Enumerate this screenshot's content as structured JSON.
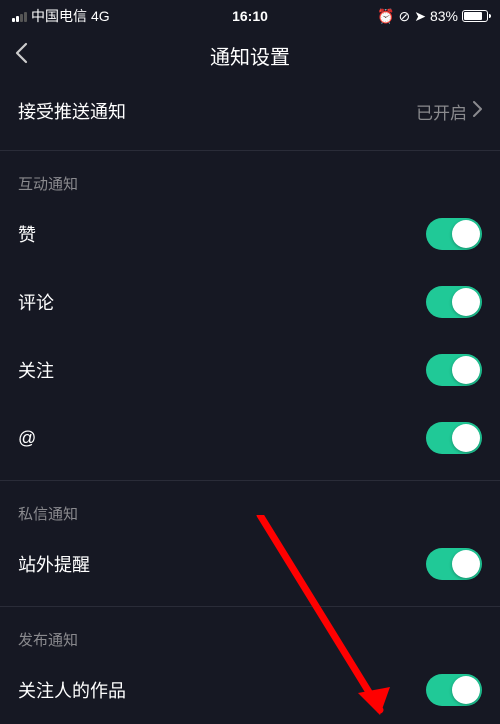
{
  "statusBar": {
    "carrier": "中国电信",
    "network": "4G",
    "time": "16:10",
    "batteryPercent": "83%",
    "icons": [
      "alarm",
      "orientation-lock",
      "location"
    ]
  },
  "nav": {
    "title": "通知设置"
  },
  "pushRow": {
    "label": "接受推送通知",
    "value": "已开启"
  },
  "sections": [
    {
      "header": "互动通知",
      "items": [
        {
          "label": "赞",
          "on": true
        },
        {
          "label": "评论",
          "on": true
        },
        {
          "label": "关注",
          "on": true
        },
        {
          "label": "@",
          "on": true
        }
      ]
    },
    {
      "header": "私信通知",
      "items": [
        {
          "label": "站外提醒",
          "on": true
        }
      ]
    },
    {
      "header": "发布通知",
      "items": [
        {
          "label": "关注人的作品",
          "on": true
        }
      ]
    }
  ],
  "colors": {
    "background": "#161823",
    "toggleOn": "#20c997",
    "secondaryText": "#8a8a8e",
    "annotationArrow": "#ff0000"
  }
}
